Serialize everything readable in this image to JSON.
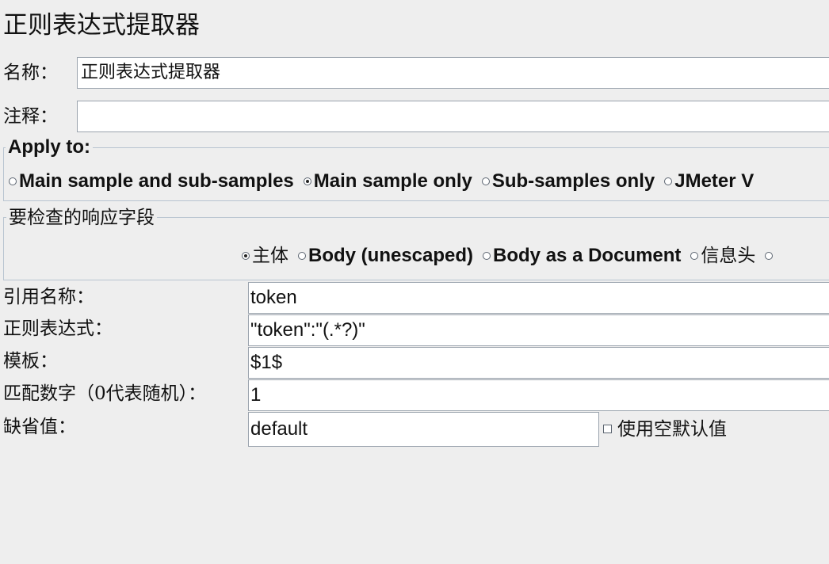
{
  "title": "正则表达式提取器",
  "name_field": {
    "label": "名称：",
    "value": "正则表达式提取器"
  },
  "comment_field": {
    "label": "注释：",
    "value": ""
  },
  "apply_to": {
    "title": "Apply to:",
    "options": [
      {
        "label": "Main sample and sub-samples",
        "selected": false
      },
      {
        "label": "Main sample only",
        "selected": true
      },
      {
        "label": "Sub-samples only",
        "selected": false
      },
      {
        "label": "JMeter V",
        "selected": false
      }
    ]
  },
  "response_field": {
    "title": "要检查的响应字段",
    "options": [
      {
        "label": "主体",
        "selected": true
      },
      {
        "label": "Body (unescaped)",
        "selected": false
      },
      {
        "label": "Body as a Document",
        "selected": false
      },
      {
        "label": "信息头",
        "selected": false
      }
    ]
  },
  "reference_name": {
    "label": "引用名称：",
    "value": "token"
  },
  "regex": {
    "label": "正则表达式：",
    "value": "\"token\":\"(.*?)\""
  },
  "template": {
    "label": "模板：",
    "value": "$1$"
  },
  "match_no": {
    "label": "匹配数字（0代表随机）：",
    "value": "1"
  },
  "default_value": {
    "label": "缺省值：",
    "value": "default",
    "use_empty_label": "使用空默认值",
    "use_empty_checked": false
  }
}
